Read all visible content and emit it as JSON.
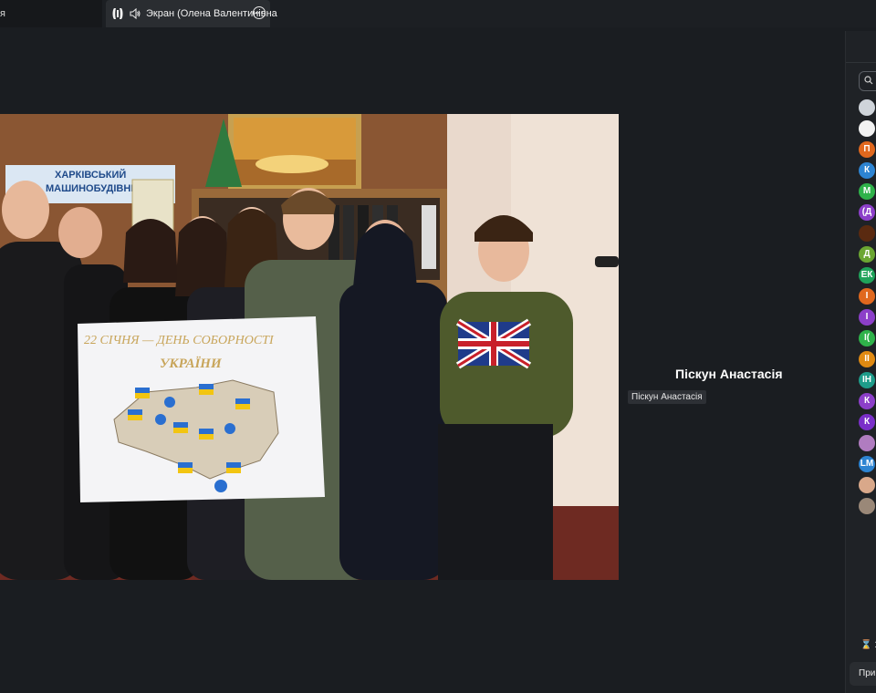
{
  "tabs": {
    "previous_label": "я",
    "active_label": "Экран (Олена Валентинівна"
  },
  "speaker": {
    "name": "Піскун Анастасія",
    "tile_label": "Піскун Анастасія"
  },
  "shared_screen": {
    "wall_sign": "ХАРКІВСЬКИЙ\nМАШИНОБУДІВНИЙ",
    "poster_title_1": "22 СІЧНЯ — ДЕНЬ СОБОРНОСТІ",
    "poster_title_2": "УКРАЇНИ"
  },
  "participants": [
    {
      "initials": "",
      "color": "#cfd4da",
      "kind": "photo"
    },
    {
      "initials": "",
      "color": "#f2f2f2",
      "kind": "photo"
    },
    {
      "initials": "П",
      "color": "#e0681e"
    },
    {
      "initials": "К",
      "color": "#2d84d2"
    },
    {
      "initials": "М",
      "color": "#2fb24a"
    },
    {
      "initials": "(Д",
      "color": "#8c3fc9"
    },
    {
      "initials": "",
      "color": "#5a2a10",
      "kind": "photo"
    },
    {
      "initials": "Д",
      "color": "#6ba632"
    },
    {
      "initials": "ЕК",
      "color": "#1fa35a"
    },
    {
      "initials": "І",
      "color": "#e0681e"
    },
    {
      "initials": "І",
      "color": "#8c3fc9"
    },
    {
      "initials": "І(",
      "color": "#2fb24a"
    },
    {
      "initials": "ІІ",
      "color": "#e08a12"
    },
    {
      "initials": "ІН",
      "color": "#1e9c8a"
    },
    {
      "initials": "К",
      "color": "#8c3fc9"
    },
    {
      "initials": "К",
      "color": "#7a2fc9"
    },
    {
      "initials": "",
      "color": "#b07cc0",
      "kind": "photo"
    },
    {
      "initials": "LM",
      "color": "#2d84d2"
    },
    {
      "initials": "",
      "color": "#d9a88a",
      "kind": "photo"
    },
    {
      "initials": "",
      "color": "#9a8878",
      "kind": "photo"
    }
  ],
  "panel_footer": {
    "count_prefix": "1",
    "button_label": "Приг"
  },
  "colors": {
    "background": "#1a1d21",
    "panel": "#1f2226"
  }
}
